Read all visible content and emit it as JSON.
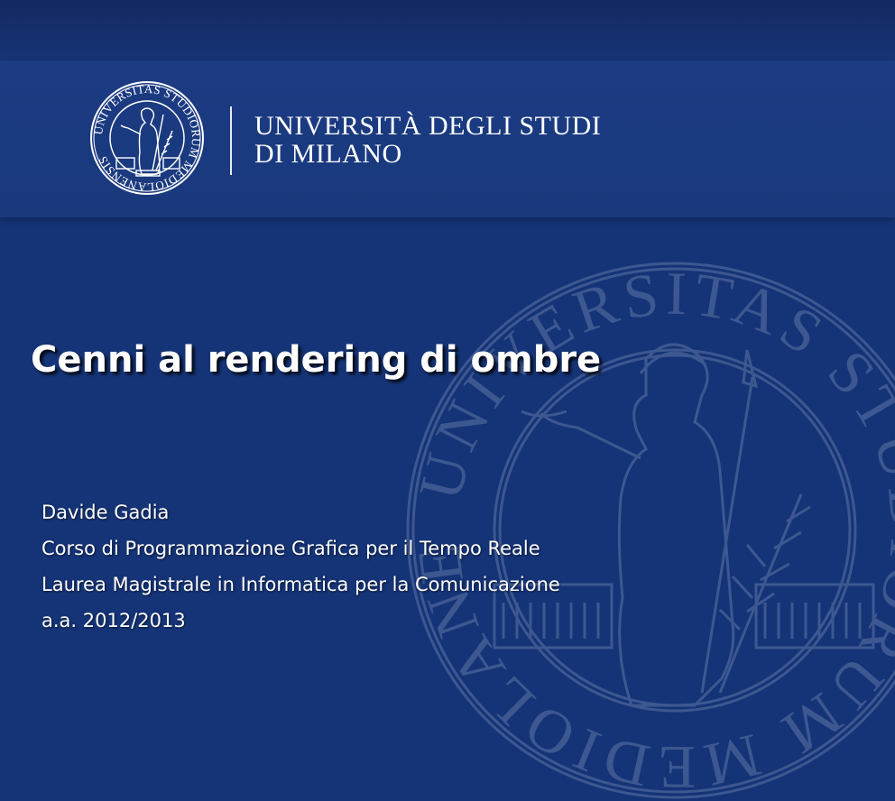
{
  "header": {
    "university_name_line1": "UNIVERSITÀ DEGLI STUDI",
    "university_name_line2": "DI MILANO"
  },
  "seal": {
    "icon": "university-seal-icon",
    "text": "UNIVERSITAS STUDIORUM MEDIOLANENSIS"
  },
  "slide": {
    "title": "Cenni al rendering di ombre",
    "author": "Davide Gadia",
    "course": "Corso di Programmazione Grafica per il Tempo Reale",
    "degree": "Laurea Magistrale in Informatica per la Comunicazione",
    "academic_year": "a.a. 2012/2013"
  },
  "colors": {
    "background": "#153477",
    "header_band": "#1c3b82",
    "text": "#ffffff"
  }
}
